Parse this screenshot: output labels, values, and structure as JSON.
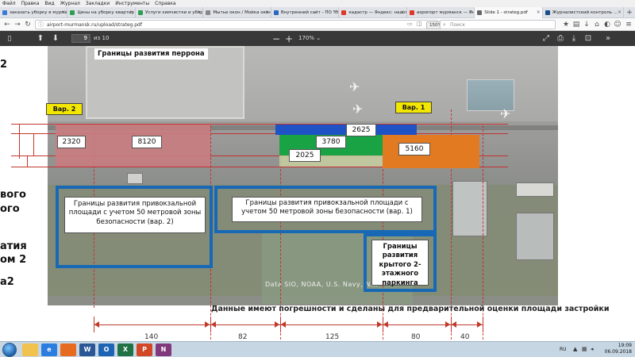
{
  "menubar": [
    "Файл",
    "Правка",
    "Вид",
    "Журнал",
    "Закладки",
    "Инструменты",
    "Справка"
  ],
  "tabs": [
    {
      "label": "заказать уборку в мурманс...",
      "fav": "#3c78d8",
      "active": false
    },
    {
      "label": "Цены на уборку квартир в ...",
      "fav": "#2e9e4f",
      "active": false
    },
    {
      "label": "Услуги химчистки и уборк...",
      "fav": "#2e9e4f",
      "active": false
    },
    {
      "label": "Мытье окон / Мойка окон ...",
      "fav": "#888888",
      "active": false
    },
    {
      "label": "Внутренний сайт - ПО \"Энерг...",
      "fav": "#2a66c2",
      "active": false
    },
    {
      "label": "кадастр — Яндекс: нашлос...",
      "fav": "#e0362c",
      "active": false
    },
    {
      "label": "аэропорт мурманск — Янд...",
      "fav": "#e0362c",
      "active": false
    },
    {
      "label": "Slide 1 - strateg.pdf",
      "fav": "#666666",
      "active": true
    },
    {
      "label": "Журналистский контроль ...",
      "fav": "#1a4c8c",
      "active": false
    }
  ],
  "nav": {
    "url": "airport-murmansk.ru/upload/strateg.pdf",
    "zoom_badge": "150%",
    "search_placeholder": "Поиск"
  },
  "pdf": {
    "page_current": "9",
    "page_count": "из 10",
    "zoom": "170%",
    "minus": "−",
    "plus": "+"
  },
  "left_labels": [
    "2",
    "вого",
    "ого",
    "атия",
    "ом 2",
    "а2"
  ],
  "slide": {
    "perron": "Границы развития перрона",
    "var2": "Вар. 2",
    "var1": "Вар. 1",
    "values": [
      "2320",
      "8120",
      "2625",
      "3780",
      "2025",
      "5160"
    ],
    "blue_left": "Границы развития привокзальной площади с учетом 50 метровой зоны безопасности (вар. 2)",
    "blue_mid": "Границы развития привокзальной площади с учетом 50 метровой зоны безопасности (вар. 1)",
    "parking": "Границы развития крытого 2-этажного паркинга",
    "watermark": "Data SIO, NOAA, U.S. Navy, N...",
    "note": "Данные имеют погрешности и сделаны для предварительной оценки площади застройки",
    "dims": [
      "140",
      "82",
      "125",
      "80",
      "40"
    ]
  },
  "colors": {
    "pink": "#c97c80",
    "green": "#1aa344",
    "blue": "#1f52c4",
    "orange": "#e27a22",
    "yellow": "#f3e600",
    "boxblue": "#1869b5"
  },
  "taskbar": {
    "apps": [
      {
        "icon": "explorer-icon",
        "label": "",
        "color": "#f2c24f"
      },
      {
        "icon": "ie-icon",
        "label": "e",
        "color": "#2b7de0"
      },
      {
        "icon": "firefox-icon",
        "label": "",
        "color": "#e66a1f"
      },
      {
        "icon": "word-icon",
        "label": "W",
        "color": "#2b5797"
      },
      {
        "icon": "outlook-icon",
        "label": "O",
        "color": "#1e64b5"
      },
      {
        "icon": "excel-icon",
        "label": "X",
        "color": "#217346"
      },
      {
        "icon": "powerpoint-icon",
        "label": "P",
        "color": "#d24726"
      },
      {
        "icon": "onenote-icon",
        "label": "N",
        "color": "#80397b"
      }
    ],
    "lang": "RU",
    "time": "19:09",
    "date": "06.09.2018"
  }
}
